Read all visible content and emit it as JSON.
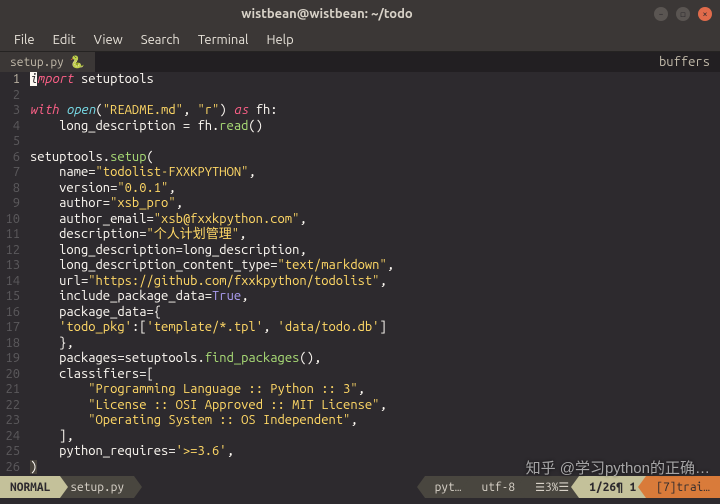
{
  "window": {
    "title": "wistbean@wistbean: ~/todo"
  },
  "menu": {
    "items": [
      "File",
      "Edit",
      "View",
      "Search",
      "Terminal",
      "Help"
    ]
  },
  "tabs": {
    "active": {
      "label": "setup.py",
      "icon": "🐍"
    },
    "buffers_label": "buffers"
  },
  "code": {
    "lines": [
      {
        "n": 1,
        "segs": [
          [
            "cursor",
            "i"
          ],
          [
            "kw",
            "mport"
          ],
          [
            "p",
            " setuptools"
          ]
        ]
      },
      {
        "n": 2,
        "segs": []
      },
      {
        "n": 3,
        "segs": [
          [
            "kw",
            "with"
          ],
          [
            "p",
            " "
          ],
          [
            "builtin",
            "open"
          ],
          [
            "p",
            "("
          ],
          [
            "str",
            "\"README.md\""
          ],
          [
            "p",
            ", "
          ],
          [
            "str",
            "\"r\""
          ],
          [
            "p",
            ") "
          ],
          [
            "kw-as",
            "as"
          ],
          [
            "p",
            " fh:"
          ]
        ]
      },
      {
        "n": 4,
        "segs": [
          [
            "p",
            "    long_description = fh."
          ],
          [
            "fn",
            "read"
          ],
          [
            "p",
            "()"
          ]
        ]
      },
      {
        "n": 5,
        "segs": []
      },
      {
        "n": 6,
        "segs": [
          [
            "p",
            "setuptools."
          ],
          [
            "fn",
            "setup"
          ],
          [
            "p",
            "("
          ]
        ]
      },
      {
        "n": 7,
        "segs": [
          [
            "p",
            "    name="
          ],
          [
            "str",
            "\"todolist-FXXKPYTHON\""
          ],
          [
            "p",
            ","
          ]
        ]
      },
      {
        "n": 8,
        "segs": [
          [
            "p",
            "    version="
          ],
          [
            "str",
            "\"0.0.1\""
          ],
          [
            "p",
            ","
          ]
        ]
      },
      {
        "n": 9,
        "segs": [
          [
            "p",
            "    author="
          ],
          [
            "str",
            "\"xsb_pro\""
          ],
          [
            "p",
            ","
          ]
        ]
      },
      {
        "n": 10,
        "segs": [
          [
            "p",
            "    author_email="
          ],
          [
            "str",
            "\"xsb@fxxkpython.com\""
          ],
          [
            "p",
            ","
          ]
        ]
      },
      {
        "n": 11,
        "segs": [
          [
            "p",
            "    description="
          ],
          [
            "str",
            "\"个人计划管理\""
          ],
          [
            "p",
            ","
          ]
        ]
      },
      {
        "n": 12,
        "segs": [
          [
            "p",
            "    long_description=long_description,"
          ]
        ]
      },
      {
        "n": 13,
        "segs": [
          [
            "p",
            "    long_description_content_type="
          ],
          [
            "str",
            "\"text/markdown\""
          ],
          [
            "p",
            ","
          ]
        ]
      },
      {
        "n": 14,
        "segs": [
          [
            "p",
            "    url="
          ],
          [
            "str",
            "\"https://github.com/fxxkpython/todolist\""
          ],
          [
            "p",
            ","
          ]
        ]
      },
      {
        "n": 15,
        "segs": [
          [
            "p",
            "    include_package_data="
          ],
          [
            "const",
            "True"
          ],
          [
            "p",
            ","
          ]
        ]
      },
      {
        "n": 16,
        "segs": [
          [
            "p",
            "    package_data={"
          ]
        ]
      },
      {
        "n": 17,
        "segs": [
          [
            "p",
            "    "
          ],
          [
            "str",
            "'todo_pkg'"
          ],
          [
            "p",
            ":["
          ],
          [
            "str",
            "'template/*.tpl'"
          ],
          [
            "p",
            ", "
          ],
          [
            "str",
            "'data/todo.db'"
          ],
          [
            "p",
            "]"
          ]
        ]
      },
      {
        "n": 18,
        "segs": [
          [
            "p",
            "    },"
          ]
        ]
      },
      {
        "n": 19,
        "segs": [
          [
            "p",
            "    packages=setuptools."
          ],
          [
            "fn",
            "find_packages"
          ],
          [
            "p",
            "(),"
          ]
        ]
      },
      {
        "n": 20,
        "segs": [
          [
            "p",
            "    classifiers=["
          ]
        ]
      },
      {
        "n": 21,
        "segs": [
          [
            "p",
            "        "
          ],
          [
            "str",
            "\"Programming Language :: Python :: 3\""
          ],
          [
            "p",
            ","
          ]
        ]
      },
      {
        "n": 22,
        "segs": [
          [
            "p",
            "        "
          ],
          [
            "str",
            "\"License :: OSI Approved :: MIT License\""
          ],
          [
            "p",
            ","
          ]
        ]
      },
      {
        "n": 23,
        "segs": [
          [
            "p",
            "        "
          ],
          [
            "str",
            "\"Operating System :: OS Independent\""
          ],
          [
            "p",
            ","
          ]
        ]
      },
      {
        "n": 24,
        "segs": [
          [
            "p",
            "    ],"
          ]
        ]
      },
      {
        "n": 25,
        "segs": [
          [
            "p",
            "    python_requires="
          ],
          [
            "str",
            "'>=3.6'"
          ],
          [
            "p",
            ","
          ]
        ]
      },
      {
        "n": 26,
        "segs": [
          [
            "hl",
            ")"
          ]
        ]
      }
    ]
  },
  "status": {
    "mode": "NORMAL",
    "file": "setup.py",
    "filetype": "pyt…",
    "encoding": "utf-8",
    "percent": "3%",
    "position": "1/26",
    "col": "¶ 1",
    "trailing": "[7]trai…"
  },
  "watermark": "知乎 @学习python的正确…"
}
